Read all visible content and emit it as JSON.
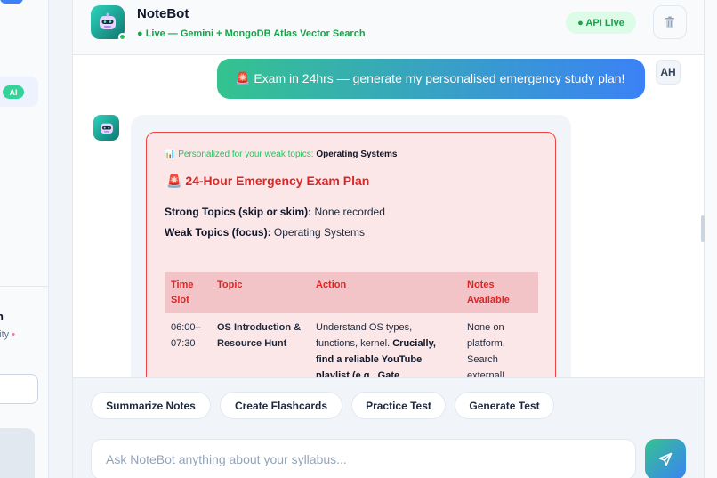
{
  "sidebar": {
    "ai_badge": "AI",
    "profile_name": "n",
    "profile_sub": "rsity",
    "profile_sub_dot": "•"
  },
  "header": {
    "bot_name": "NoteBot",
    "status": "● Live — Gemini + MongoDB Atlas Vector Search",
    "api_badge": "● API Live",
    "trash_icon": "trash-icon"
  },
  "conversation": {
    "user_message": "🚨 Exam in 24hrs — generate my personalised emergency study plan!",
    "user_initials": "AH",
    "plan": {
      "personalized_label": "📊 Personalized for your weak topics:",
      "personalized_topic": "Operating Systems",
      "title": "🚨 24-Hour Emergency Exam Plan",
      "strong_label": "Strong Topics (skip or skim):",
      "strong_value": "None recorded",
      "weak_label": "Weak Topics (focus):",
      "weak_value": "Operating Systems",
      "table_headers": [
        "Time Slot",
        "Topic",
        "Action",
        "Notes Available"
      ],
      "rows": [
        {
          "slot": "06:00–07:30",
          "topic": "OS Introduction & Resource Hunt",
          "action_plain": "Understand OS types, functions, kernel.",
          "action_bold": "Crucially, find a reliable YouTube playlist (e.g., Gate",
          "notes": "None on platform. Search external!"
        }
      ]
    }
  },
  "quick_actions": [
    "Summarize Notes",
    "Create Flashcards",
    "Practice Test",
    "Generate Test"
  ],
  "composer": {
    "placeholder": "Ask NoteBot anything about your syllabus...",
    "send_icon": "send-icon"
  },
  "colors": {
    "accent_green": "#34c38f",
    "accent_blue": "#3b82f6",
    "plan_red": "#dc2626",
    "plan_bg": "#fbe7e8"
  }
}
